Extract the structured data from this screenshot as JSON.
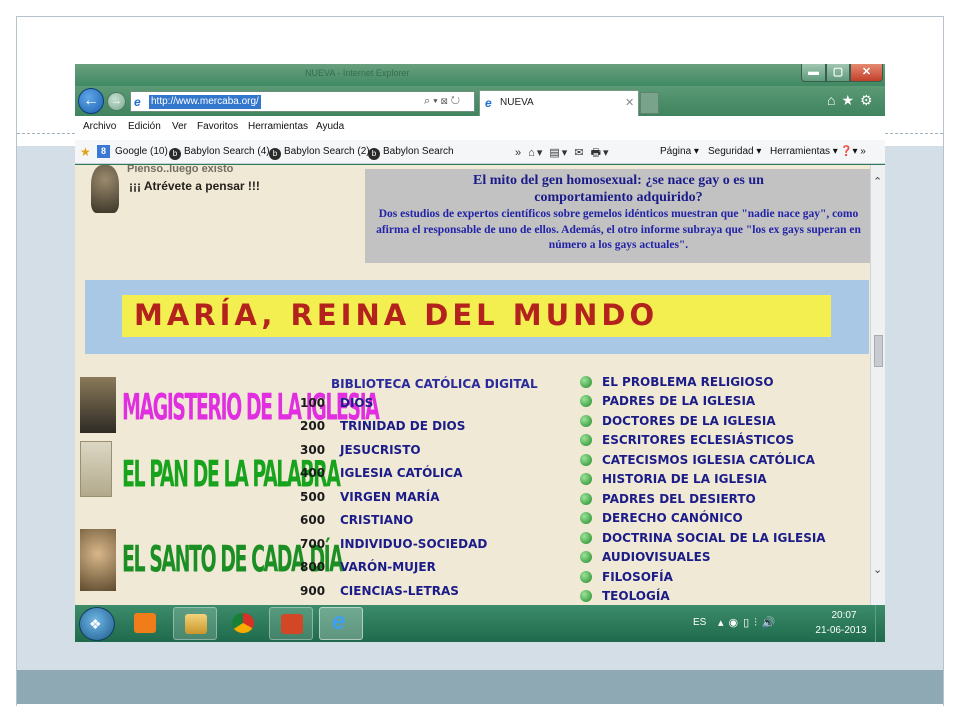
{
  "browser": {
    "address": "http://www.mercaba.org/",
    "tab_label": "NUEVA",
    "title": "NUEVA - Internet Explorer"
  },
  "menu": [
    "Archivo",
    "Edición",
    "Ver",
    "Favoritos",
    "Herramientas",
    "Ayuda"
  ],
  "favorites": [
    "Google (10)",
    "Babylon Search (4)",
    "Babylon Search (2)",
    "Babylon Search"
  ],
  "commandbar": {
    "pagina": "Página ▾",
    "seguridad": "Seguridad ▾",
    "herramientas": "Herramientas ▾"
  },
  "page": {
    "thinker_cut": "Pienso..luego existo",
    "thinker_text": "¡¡¡ Atrévete a pensar !!!",
    "news_title": "El mito del gen homosexual: ¿se nace gay o es un comportamiento adquirido?",
    "news_body": "Dos estudios de expertos científicos sobre gemelos idénticos muestran que \"nadie nace gay\", como afirma el responsable de uno de ellos. Además, el otro informe subraya que \"los ex gays superan en número a los gays actuales\".",
    "banner": "MARÍA, REINA DEL MUNDO",
    "sections": [
      "MAGISTERIO DE LA IGLESIA",
      "EL PAN DE LA PALABRA",
      "EL SANTO DE CADA DÍA"
    ],
    "biblioteca_header": "BIBLIOTECA CATÓLICA DIGITAL",
    "biblioteca": [
      {
        "num": "100",
        "label": "DIOS"
      },
      {
        "num": "200",
        "label": "TRINIDAD DE DIOS"
      },
      {
        "num": "300",
        "label": "JESUCRISTO"
      },
      {
        "num": "400",
        "label": "IGLESIA CATÓLICA"
      },
      {
        "num": "500",
        "label": "VIRGEN MARÍA"
      },
      {
        "num": "600",
        "label": "CRISTIANO"
      },
      {
        "num": "700",
        "label": "INDIVIDUO-SOCIEDAD"
      },
      {
        "num": "800",
        "label": "VARÓN-MUJER"
      },
      {
        "num": "900",
        "label": "CIENCIAS-LETRAS"
      }
    ],
    "categories": [
      "EL PROBLEMA RELIGIOSO",
      "PADRES DE LA IGLESIA",
      "DOCTORES DE LA IGLESIA",
      "ESCRITORES ECLESIÁSTICOS",
      "CATECISMOS IGLESIA CATÓLICA",
      "HISTORIA DE LA IGLESIA",
      "PADRES DEL DESIERTO",
      "DERECHO CANÓNICO",
      "DOCTRINA SOCIAL DE LA IGLESIA",
      "AUDIOVISUALES",
      "FILOSOFÍA",
      "TEOLOGÍA"
    ]
  },
  "taskbar": {
    "lang": "ES",
    "time": "20:07",
    "date": "21-06-2013"
  },
  "colors": {
    "banner_bg": "#a9c8e6",
    "banner_inner": "#f4ef50",
    "banner_text": "#b3221c",
    "news_box": "#c2c2c2",
    "page_bg": "#efe9d6",
    "taskbar": "#2a7a5a"
  }
}
